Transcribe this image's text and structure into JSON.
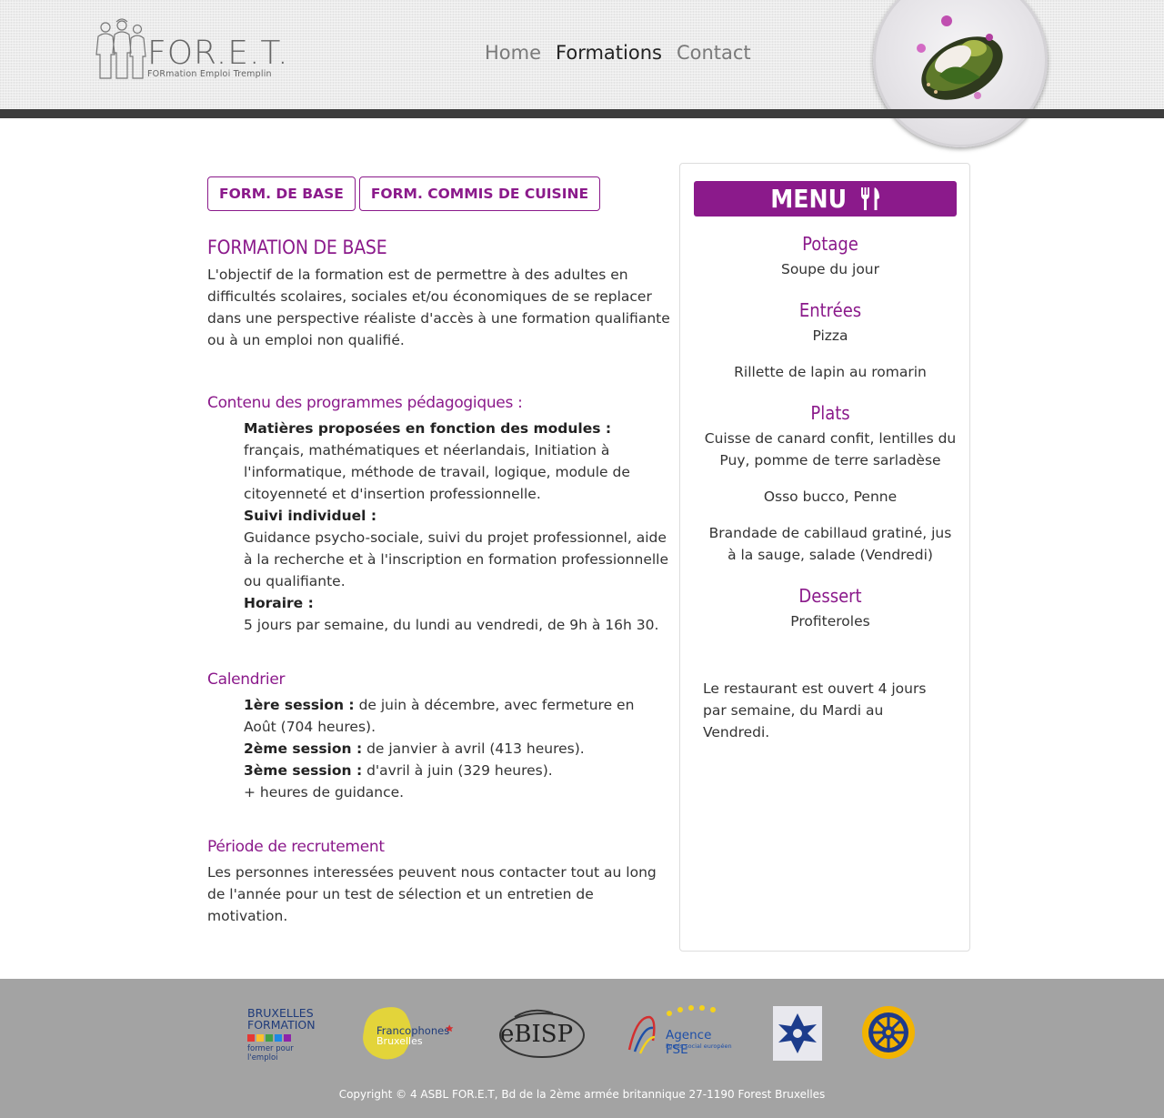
{
  "header": {
    "logo_name": "FOR.E.T.",
    "logo_tagline": "FORmation Emploi Tremplin",
    "nav": [
      {
        "label": "Home"
      },
      {
        "label": "Formations"
      },
      {
        "label": "Contact"
      }
    ],
    "active_nav": "Formations"
  },
  "main": {
    "buttons": [
      "FORM. DE BASE",
      "FORM. COMMIS DE CUISINE"
    ],
    "title": "FORMATION DE BASE",
    "intro": "L'objectif de la formation est de permettre à des adultes en difficultés scolaires, sociales et/ou économiques de se replacer dans une perspective réaliste d'accès à une formation qualifiante ou à un emploi non qualifié.",
    "programme": {
      "heading": "Contenu des programmes pédagogiques :",
      "matieres_label": "Matières proposées en fonction des modules :",
      "matieres_text": "français, mathématiques et néerlandais, Initiation à l'informatique, méthode de travail, logique, module de citoyenneté et d'insertion professionnelle.",
      "suivi_label": "Suivi individuel :",
      "suivi_text": "Guidance psycho-sociale, suivi du projet professionnel, aide à la recherche et à l'inscription en formation professionnelle ou qualifiante.",
      "horaire_label": "Horaire :",
      "horaire_text": "5 jours par semaine, du lundi au vendredi, de 9h à 16h 30."
    },
    "calendrier": {
      "heading": "Calendrier",
      "s1_label": "1ère session :",
      "s1_text": " de juin à décembre, avec fermeture en Août (704 heures).",
      "s2_label": "2ème session :",
      "s2_text": " de janvier à avril (413 heures).",
      "s3_label": "3ème session :",
      "s3_text": " d'avril à juin (329 heures).",
      "extra": "+ heures de guidance."
    },
    "recrutement": {
      "heading": "Période de recrutement",
      "text": "Les personnes interessées peuvent nous contacter tout au long de l'année pour un test de sélection et un entretien de motivation."
    }
  },
  "menu": {
    "title": "MENU",
    "icon": "fork-knife-icon",
    "sections": [
      {
        "name": "Potage",
        "dishes": [
          "Soupe du jour"
        ]
      },
      {
        "name": "Entrées",
        "dishes": [
          "Pizza",
          "Rillette de lapin au romarin"
        ]
      },
      {
        "name": "Plats",
        "dishes": [
          "Cuisse de canard confit, lentilles du Puy, pomme de terre sarladèse",
          "Osso bucco, Penne",
          "Brandade de cabillaud gratiné, jus à la sauge, salade (Vendredi)"
        ]
      },
      {
        "name": "Dessert",
        "dishes": [
          "Profiteroles"
        ]
      }
    ],
    "note": "Le restaurant est ouvert 4 jours par semaine, du Mardi au Vendredi."
  },
  "footer": {
    "partners": [
      {
        "name": "BRUXELLES FORMATION",
        "line1": "BRUXELLES",
        "line2": "FORMATION",
        "tagline": "former pour l'emploi"
      },
      {
        "name": "Francophones Bruxelles",
        "line1": "Francophones",
        "line2": "Bruxelles"
      },
      {
        "name": "eBISP",
        "text": "eBISP"
      },
      {
        "name": "Agence FSE",
        "text": "Agence FSE",
        "sub": "Fonds social européen"
      },
      {
        "name": "cross-emblem"
      },
      {
        "name": "rotary-wheel"
      }
    ],
    "copyright": "Copyright © 4 ASBL FOR.E.T, Bd de la 2ème armée britannique 27-1190 Forest Bruxelles"
  },
  "colors": {
    "accent": "#8b1a8b",
    "header_bar": "#3d3d3d",
    "footer_bg": "#a3a3a3"
  }
}
